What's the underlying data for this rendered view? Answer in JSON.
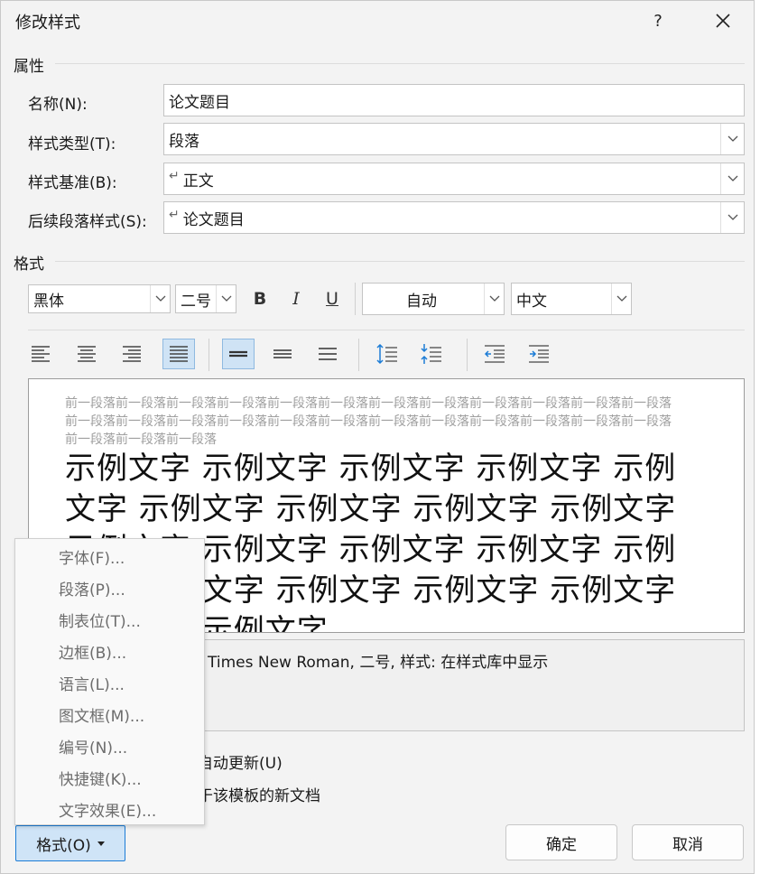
{
  "dialog": {
    "title": "修改样式",
    "help": "?",
    "close_icon": "close-icon"
  },
  "properties": {
    "heading": "属性",
    "name_label": "名称(N):",
    "name_value": "论文题目",
    "type_label": "样式类型(T):",
    "type_value": "段落",
    "based_label": "样式基准(B):",
    "based_value": "正文",
    "next_label": "后续段落样式(S):",
    "next_value": "论文题目",
    "para_mark": "↵"
  },
  "format": {
    "heading": "格式",
    "font": "黑体",
    "size": "二号",
    "bold": "B",
    "italic": "I",
    "underline": "U",
    "color": "自动",
    "script": "中文"
  },
  "preview": {
    "prev_para": "前一段落前一段落前一段落前一段落前一段落前一段落前一段落前一段落前一段落前一段落前一段落前一段落前一段落前一段落前一段落前一段落前一段落前一段落前一段落前一段落前一段落前一段落前一段落前一段落前一段落前一段落前一段落",
    "sample": "示例文字 示例文字 示例文字 示例文字 示例文字 示例文字 示例文字 示例文字 示例文字 示例文字 示例文字 示例文字 示例文字 示例文字 示例文字 示例文字 示例文字 示例文字 示例文字 示例文字"
  },
  "description": {
    "text": "Times New Roman, 二号, 样式: 在样式库中显示"
  },
  "options": {
    "auto_update": "自动更新(U)",
    "new_docs": "于该模板的新文档"
  },
  "buttons": {
    "format": "格式(O)",
    "ok": "确定",
    "cancel": "取消"
  },
  "menu": {
    "items": [
      {
        "label": "字体(F)..."
      },
      {
        "label": "段落(P)..."
      },
      {
        "label": "制表位(T)..."
      },
      {
        "label": "边框(B)..."
      },
      {
        "label": "语言(L)..."
      },
      {
        "label": "图文框(M)..."
      },
      {
        "label": "编号(N)..."
      },
      {
        "label": "快捷键(K)..."
      },
      {
        "label": "文字效果(E)..."
      }
    ]
  },
  "colors": {
    "accent": "#1c7cd6",
    "active_bg": "#cfe3f5"
  }
}
